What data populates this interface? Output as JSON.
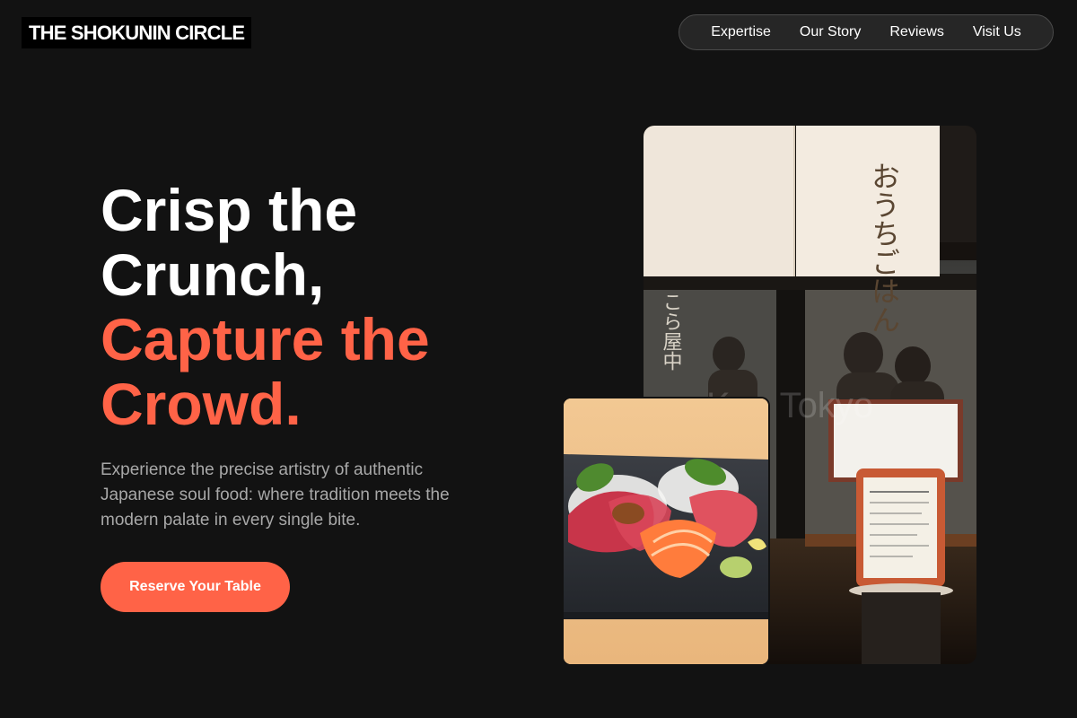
{
  "header": {
    "logo": "THE SHOKUNIN CIRCLE",
    "nav": [
      "Expertise",
      "Our Story",
      "Reviews",
      "Visit Us"
    ]
  },
  "hero": {
    "headline_white": [
      "Crisp the",
      "Crunch,"
    ],
    "headline_accent": [
      "Capture the",
      "Crowd."
    ],
    "subtext": "Experience the precise artistry of authentic Japanese soul food: where tradition meets the modern palate in every single bite.",
    "cta_label": "Reserve Your Table"
  },
  "images": {
    "storefront": {
      "description": "storefront-photo",
      "noren_text": "おうちごはん",
      "sign_text": "こら屋中",
      "watermark": "Ken Tokyo"
    },
    "sashimi": {
      "description": "sashimi-photo"
    }
  },
  "colors": {
    "background": "#121212",
    "accent": "#ff6347",
    "text_primary": "#ffffff",
    "text_secondary": "#a8a8a8",
    "nav_bg": "#262626"
  }
}
